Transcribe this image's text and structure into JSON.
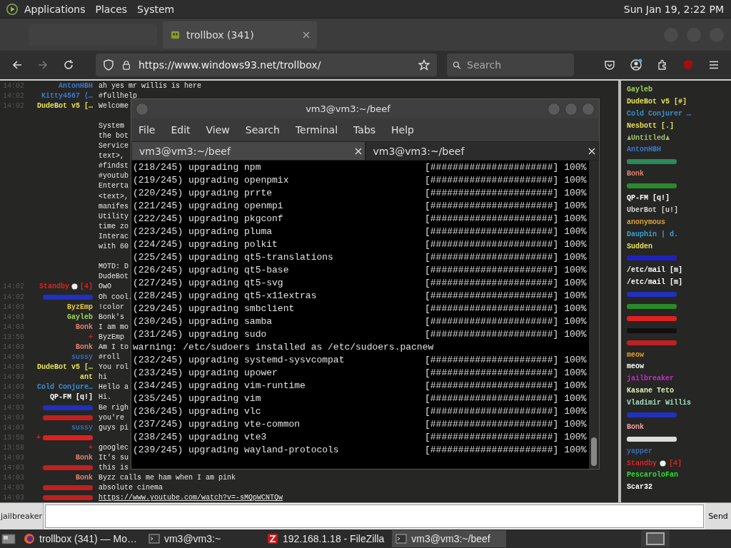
{
  "top_panel": {
    "menus": [
      "Applications",
      "Places",
      "System"
    ],
    "clock": "Sun Jan 19,  2:22 PM"
  },
  "browser": {
    "tabs": [
      {
        "title": "trollbox (341)",
        "selected": true
      }
    ],
    "url": "https://www.windows93.net/trollbox/",
    "search": {
      "placeholder": "Search"
    }
  },
  "chat": {
    "messages": [
      {
        "time": "14:02",
        "nick": "AntonHBH",
        "color": "#3a7ad0",
        "paragraphs": [
          [
            "ah yes mr willis is here"
          ]
        ]
      },
      {
        "time": "14:02",
        "nick": "Kitty4567 (…",
        "color": "#3a7ad0",
        "paragraphs": [
          [
            "#fullhelp"
          ]
        ]
      },
      {
        "time": "14:02",
        "nick": "DudeBot v5 […",
        "color": "#e6e15a",
        "paragraphs": [
          [
            "Welcome"
          ],
          [
            "System",
            "the bot",
            "Service",
            "text>,",
            "#findst",
            "#youtub",
            "Enterta",
            "<text>,",
            "manifes",
            "Utility",
            "time zo",
            "Interac",
            "with 60"
          ],
          [
            "MOTD: D",
            "DudeBot"
          ]
        ]
      },
      {
        "time": "14:02",
        "nick": "Standby",
        "tag": "[4]",
        "color": "#e02020",
        "paragraphs": [
          [
            "OwO"
          ]
        ]
      },
      {
        "time": "14:02",
        "color": "#2030c0",
        "paragraphs": [
          [
            "Oh cool."
          ]
        ]
      },
      {
        "time": "14:03",
        "nick": "ByzEmp",
        "color": "#e6c84a",
        "paragraphs": [
          [
            "!color"
          ]
        ]
      },
      {
        "time": "14:03",
        "nick": "Gayleb",
        "color": "#9fd65a",
        "paragraphs": [
          [
            "Bonk's"
          ]
        ]
      },
      {
        "time": "14:03",
        "nick": "Bonk",
        "color": "#e08070",
        "paragraphs": [
          [
            "I am mo"
          ]
        ]
      },
      {
        "time": "13:58",
        "nick": "+",
        "color": "#e02020",
        "paragraphs": [
          [
            "ByzEmp"
          ]
        ]
      },
      {
        "time": "14:03",
        "nick": "Bonk",
        "color": "#e08070",
        "paragraphs": [
          [
            "Am I to"
          ]
        ]
      },
      {
        "time": "14:03",
        "nick": "sussy",
        "color": "#3a6ab0",
        "paragraphs": [
          [
            "#roll"
          ]
        ]
      },
      {
        "time": "14:03",
        "nick": "DudeBot v5 […",
        "color": "#e6e15a",
        "paragraphs": [
          [
            "You rol"
          ]
        ]
      },
      {
        "time": "14:03",
        "nick": "ant",
        "color": "#e6e15a",
        "paragraphs": [
          [
            "hi"
          ]
        ]
      },
      {
        "time": "14:03",
        "nick": "Cold Conjure…",
        "color": "#3a8fd0",
        "paragraphs": [
          [
            "Hello a"
          ]
        ]
      },
      {
        "time": "14:03",
        "nick": "QP-FM [q!]",
        "color": "#ffffff",
        "paragraphs": [
          [
            "Hi."
          ]
        ]
      },
      {
        "time": "14:03",
        "color": "#2030c0",
        "paragraphs": [
          [
            "Be righ"
          ]
        ]
      },
      {
        "time": "14:03",
        "color": "#c02020",
        "paragraphs": [
          [
            "you're"
          ]
        ]
      },
      {
        "time": "14:03",
        "nick": "sussy",
        "color": "#3a6ab0",
        "paragraphs": [
          [
            "guys pi"
          ]
        ]
      },
      {
        "time": "13:58",
        "nick": "+",
        "color": "#e02020"
      },
      {
        "time": "13:58",
        "nick": "+",
        "color": "#e02020",
        "paragraphs": [
          [
            "googlec"
          ]
        ]
      },
      {
        "time": "14:03",
        "nick": "Bonk",
        "color": "#e08070",
        "paragraphs": [
          [
            "It's su"
          ]
        ]
      },
      {
        "time": "14:03",
        "color": "#c02020",
        "paragraphs": [
          [
            "this is"
          ]
        ]
      },
      {
        "time": "14:03",
        "nick": "Bonk",
        "color": "#e08070",
        "paragraphs": [
          [
            "Byzz calls me ham when I am pink"
          ]
        ]
      },
      {
        "time": "14:03",
        "color": "#c02020",
        "paragraphs": [
          [
            "absolute cinema"
          ]
        ]
      },
      {
        "time": "14:03",
        "color": "#c02020",
        "link": true,
        "paragraphs": [
          [
            "https://www.youtube.com/watch?v=-sMQpWCNTQw"
          ]
        ]
      }
    ],
    "users": [
      {
        "name": "Gayleb",
        "color": "#9fd65a"
      },
      {
        "name": "DudeBot v5 [#]",
        "color": "#e6e15a"
      },
      {
        "name": "Cold Conjurer …",
        "color": "#3a8fd0"
      },
      {
        "name": "Nesbott [.]",
        "color": "#e6e15a"
      },
      {
        "name": "♟Untitled♟",
        "color": "#a0c070"
      },
      {
        "name": "AntonHBH",
        "color": "#3a7ad0"
      },
      {
        "color": "#2a8a5a"
      },
      {
        "name": "Bonk",
        "color": "#e08070"
      },
      {
        "color": "#2a8a2a"
      },
      {
        "name": "QP-FM [q!]",
        "color": "#ffffff"
      },
      {
        "name": "UberBot [u!]",
        "color": "#d0d0d0"
      },
      {
        "name": "anonymous",
        "color": "#e0a030"
      },
      {
        "name": "Dauphin | d.",
        "color": "#3aa0d0"
      },
      {
        "name": "Sudden",
        "color": "#e6e15a"
      },
      {
        "color": "#2020c0"
      },
      {
        "name": "/etc/mail [m]",
        "color": "#ffffff"
      },
      {
        "name": "/etc/mail [m]",
        "color": "#ffffff"
      },
      {
        "color": "#2030c0"
      },
      {
        "color": "#2a8a2a"
      },
      {
        "color": "#e02020"
      },
      {
        "color": "#111111"
      },
      {
        "color": "#c02020"
      },
      {
        "name": "meow",
        "color": "#e0a030"
      },
      {
        "name": "meow",
        "color": "#ffffff"
      },
      {
        "name": "jailbreaker",
        "color": "#c030c0"
      },
      {
        "name": "Kasane Teto",
        "color": "#e0f0c0"
      },
      {
        "name": "Vladimir Willis",
        "color": "#a0e0c0"
      },
      {
        "color": "#2030c0"
      },
      {
        "name": "Bonk",
        "color": "#f0a0a0"
      },
      {
        "color": "#dddddd"
      },
      {
        "name": "yapper",
        "color": "#3a6ab0"
      },
      {
        "name": "Standby",
        "tag": "[4]",
        "color": "#e02020"
      },
      {
        "name": "PescaroloFan",
        "color": "#30e030"
      },
      {
        "name": "Scar32",
        "color": "#ffffff"
      }
    ],
    "input": {
      "nick": "jailbreaker",
      "button": "Send"
    }
  },
  "terminal": {
    "title": "vm3@vm3:~/beef",
    "menu": [
      "File",
      "Edit",
      "View",
      "Search",
      "Terminal",
      "Tabs",
      "Help"
    ],
    "tabs": [
      {
        "title": "vm3@vm3:~/beef",
        "selected": true
      },
      {
        "title": "vm3@vm3:~/beef",
        "selected": false
      }
    ],
    "lines": [
      {
        "kind": "progress",
        "text": "(218/245) upgrading npm",
        "bar": "[######################]",
        "percent": "100%"
      },
      {
        "kind": "progress",
        "text": "(219/245) upgrading openpmix",
        "bar": "[######################]",
        "percent": "100%"
      },
      {
        "kind": "progress",
        "text": "(220/245) upgrading prrte",
        "bar": "[######################]",
        "percent": "100%"
      },
      {
        "kind": "progress",
        "text": "(221/245) upgrading openmpi",
        "bar": "[######################]",
        "percent": "100%"
      },
      {
        "kind": "progress",
        "text": "(222/245) upgrading pkgconf",
        "bar": "[######################]",
        "percent": "100%"
      },
      {
        "kind": "progress",
        "text": "(223/245) upgrading pluma",
        "bar": "[######################]",
        "percent": "100%"
      },
      {
        "kind": "progress",
        "text": "(224/245) upgrading polkit",
        "bar": "[######################]",
        "percent": "100%"
      },
      {
        "kind": "progress",
        "text": "(225/245) upgrading qt5-translations",
        "bar": "[######################]",
        "percent": "100%"
      },
      {
        "kind": "progress",
        "text": "(226/245) upgrading qt5-base",
        "bar": "[######################]",
        "percent": "100%"
      },
      {
        "kind": "progress",
        "text": "(227/245) upgrading qt5-svg",
        "bar": "[######################]",
        "percent": "100%"
      },
      {
        "kind": "progress",
        "text": "(228/245) upgrading qt5-x11extras",
        "bar": "[######################]",
        "percent": "100%"
      },
      {
        "kind": "progress",
        "text": "(229/245) upgrading smbclient",
        "bar": "[######################]",
        "percent": "100%"
      },
      {
        "kind": "progress",
        "text": "(230/245) upgrading samba",
        "bar": "[######################]",
        "percent": "100%"
      },
      {
        "kind": "progress",
        "text": "(231/245) upgrading sudo",
        "bar": "[######################]",
        "percent": "100%"
      },
      {
        "kind": "plain",
        "text": "warning: /etc/sudoers installed as /etc/sudoers.pacnew"
      },
      {
        "kind": "progress",
        "text": "(232/245) upgrading systemd-sysvcompat",
        "bar": "[######################]",
        "percent": "100%"
      },
      {
        "kind": "progress",
        "text": "(233/245) upgrading upower",
        "bar": "[######################]",
        "percent": "100%"
      },
      {
        "kind": "progress",
        "text": "(234/245) upgrading vim-runtime",
        "bar": "[######################]",
        "percent": "100%"
      },
      {
        "kind": "progress",
        "text": "(235/245) upgrading vim",
        "bar": "[######################]",
        "percent": "100%"
      },
      {
        "kind": "progress",
        "text": "(236/245) upgrading vlc",
        "bar": "[######################]",
        "percent": "100%"
      },
      {
        "kind": "progress",
        "text": "(237/245) upgrading vte-common",
        "bar": "[######################]",
        "percent": "100%"
      },
      {
        "kind": "progress",
        "text": "(238/245) upgrading vte3",
        "bar": "[######################]",
        "percent": "100%"
      },
      {
        "kind": "progress",
        "text": "(239/245) upgrading wayland-protocols",
        "bar": "[######################]",
        "percent": "100%"
      }
    ]
  },
  "taskbar": {
    "items": [
      {
        "kind": "firefox",
        "title": "trollbox (341) — Mo…",
        "selected": false
      },
      {
        "kind": "terminal",
        "title": "vm3@vm3:~",
        "selected": false
      },
      {
        "kind": "filezilla",
        "title": "192.168.1.18 - FileZilla",
        "selected": false
      },
      {
        "kind": "terminal",
        "title": "vm3@vm3:~/beef",
        "selected": true
      }
    ]
  }
}
